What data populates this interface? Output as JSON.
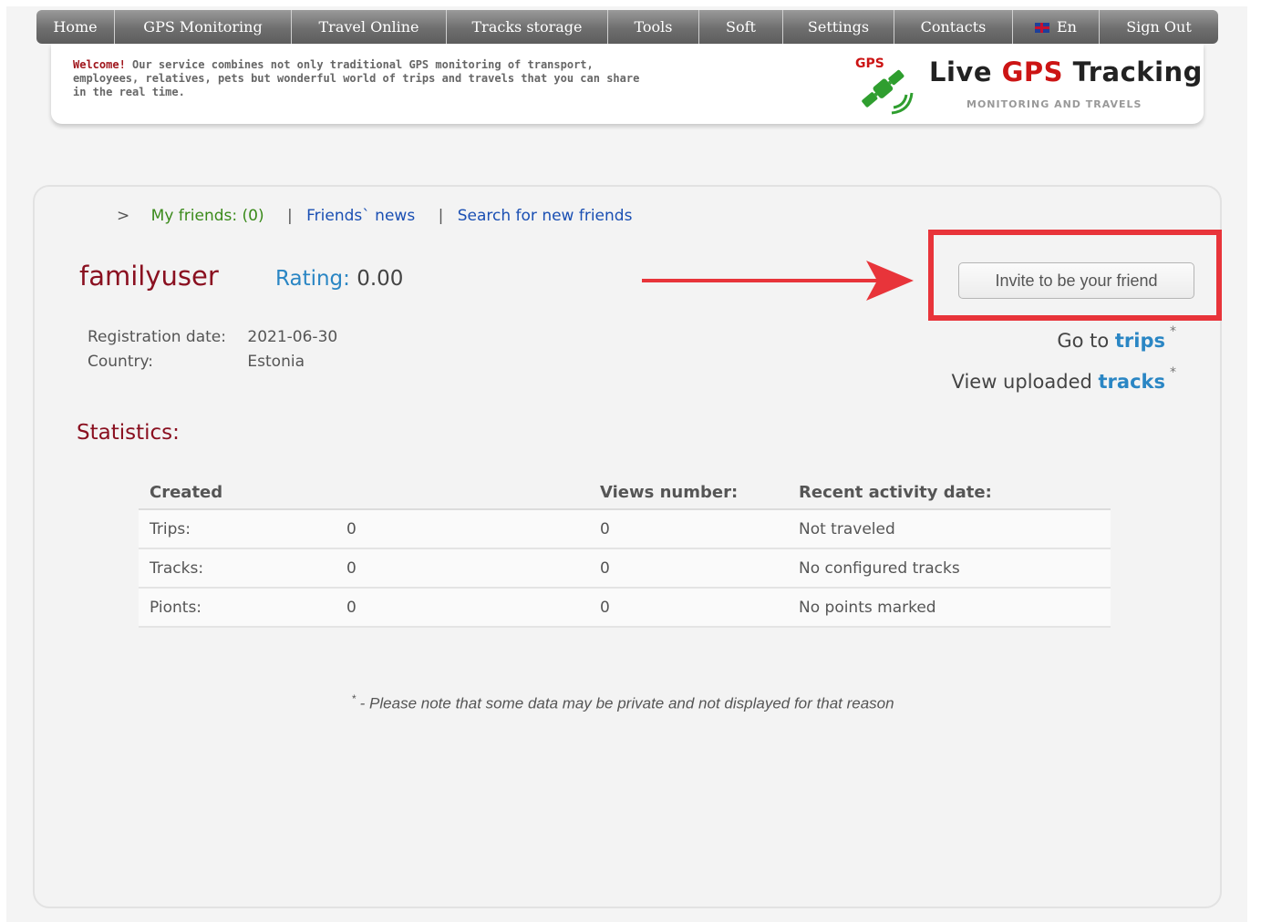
{
  "nav": {
    "items": [
      "Home",
      "GPS Monitoring",
      "Travel Online",
      "Tracks storage",
      "Tools",
      "Soft",
      "Settings",
      "Contacts",
      "En",
      "Sign Out"
    ]
  },
  "header": {
    "welcome_label": "Welcome!",
    "welcome_text": "Our service combines not only traditional GPS monitoring of transport, employees, relatives, pets but wonderful world of trips and travels that you can share in the real time.",
    "logo_icon_label": "GPS",
    "logo_title_prefix": "Live ",
    "logo_title_gps": "GPS",
    "logo_title_suffix": " Tracking",
    "logo_subtitle": "MONITORING AND TRAVELS"
  },
  "friends_nav": {
    "arrow": ">",
    "my_friends": "My friends: (0)",
    "sep": "|",
    "friends_news": "Friends` news",
    "search": "Search for new friends"
  },
  "profile": {
    "username": "familyuser",
    "rating_label": "Rating:",
    "rating_value": "0.00",
    "invite_button": "Invite to be your friend",
    "go_to_prefix": "Go to ",
    "go_to_link": "trips",
    "view_prefix": "View uploaded ",
    "view_link": "tracks",
    "asterisk": "*",
    "registration_label": "Registration date:",
    "registration_value": "2021-06-30",
    "country_label": "Country:",
    "country_value": "Estonia"
  },
  "statistics": {
    "title": "Statistics:",
    "headers": [
      "Created",
      "",
      "Views number:",
      "Recent activity date:"
    ],
    "rows": [
      [
        "Trips:",
        "0",
        "0",
        "Not traveled"
      ],
      [
        "Tracks:",
        "0",
        "0",
        "No configured tracks"
      ],
      [
        "Pionts:",
        "0",
        "0",
        "No points marked"
      ]
    ]
  },
  "footnote": {
    "mark": "*",
    "text": "- Please note that some data may be private and not displayed for that reason"
  },
  "colors": {
    "accent_red": "#e8343a",
    "username": "#8a1020",
    "link_blue": "#1a4fb3",
    "link_green": "#3a8a1a"
  }
}
